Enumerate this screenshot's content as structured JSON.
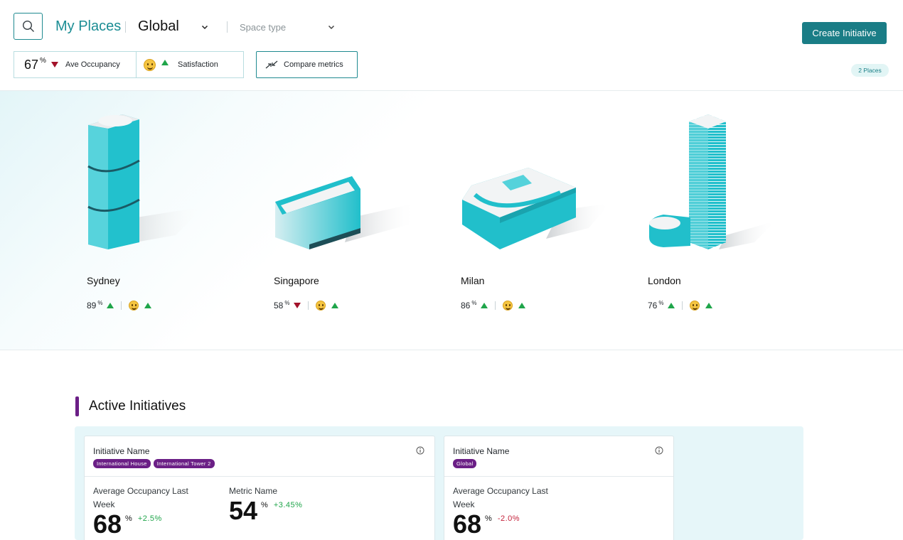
{
  "header": {
    "title": "My Places",
    "region": "Global",
    "space_type_placeholder": "Space type",
    "create_button": "Create Initiative",
    "occupancy_value": "67",
    "percent_symbol": "%",
    "occupancy_label": "Ave Occupancy",
    "satisfaction_label": "Satisfaction",
    "compare_button": "Compare metrics",
    "places_count": "2 Places"
  },
  "colors": {
    "teal_primary": "#1a7d86",
    "building_teal": "#21bfcb",
    "trend_up": "#1fa54a",
    "trend_down": "#a3122a",
    "tag_purple": "#6b1f86"
  },
  "places": [
    {
      "name": "Sydney",
      "occupancy": "89",
      "occupancy_trend": "up",
      "satisfaction_trend": "up"
    },
    {
      "name": "Singapore",
      "occupancy": "58",
      "occupancy_trend": "down",
      "satisfaction_trend": "up"
    },
    {
      "name": "Milan",
      "occupancy": "86",
      "occupancy_trend": "up",
      "satisfaction_trend": "up"
    },
    {
      "name": "London",
      "occupancy": "76",
      "occupancy_trend": "up",
      "satisfaction_trend": "up"
    }
  ],
  "initiatives": {
    "heading": "Active Initiatives",
    "cards": [
      {
        "title": "Initiative Name",
        "tags": [
          "International House",
          "International Tower 2"
        ],
        "metrics": [
          {
            "label": "Average Occupancy Last Week",
            "value": "68",
            "unit": "%",
            "delta": "+2.5%"
          },
          {
            "label": "Metric Name",
            "value": "54",
            "unit": "%",
            "delta": "+3.45%"
          }
        ]
      },
      {
        "title": "Initiative Name",
        "tags": [
          "Global"
        ],
        "metrics": [
          {
            "label": "Average Occupancy Last Week",
            "value": "68",
            "unit": "%",
            "delta": "-2.0%"
          }
        ]
      }
    ]
  }
}
